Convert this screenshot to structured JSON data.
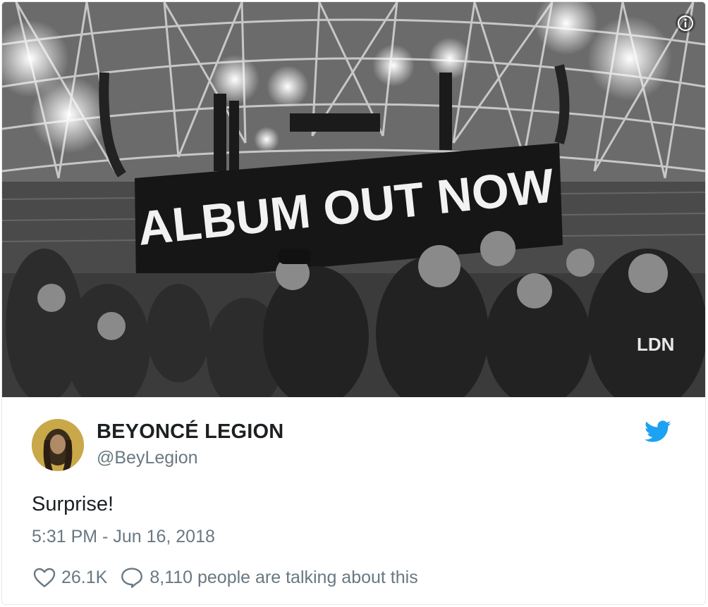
{
  "tweet": {
    "photo": {
      "screen_text": "ALBUM OUT NOW",
      "shirt_text": "LDN",
      "info_icon": "info-icon"
    },
    "author": {
      "name": "BEYONCÉ LEGION",
      "handle": "@BeyLegion",
      "avatar_icon": "avatar",
      "brand_icon": "twitter-bird-icon"
    },
    "text": "Surprise!",
    "timestamp": "5:31 PM - Jun 16, 2018",
    "likes": "26.1K",
    "replies": "8,110 people are talking about this",
    "colors": {
      "name": "#1c2022",
      "meta": "#697882",
      "twitter_blue": "#1da1f2",
      "border": "#e1e8ed"
    }
  }
}
